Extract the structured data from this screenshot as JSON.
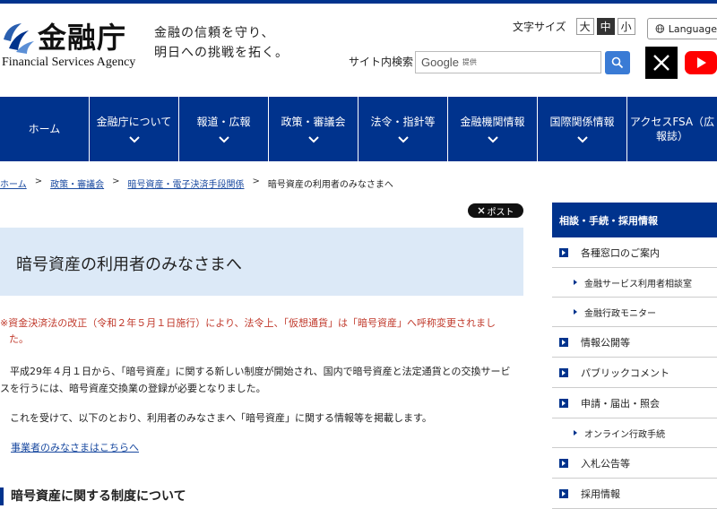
{
  "header": {
    "org_name": "金融庁",
    "org_name_en": "Financial Services Agency",
    "tagline_line1": "金融の信頼を守り、",
    "tagline_line2": "明日への挑戦を拓く。",
    "font_size_label": "文字サイズ",
    "font_sizes": [
      "大",
      "中",
      "小"
    ],
    "font_size_selected": "中",
    "language_label": "Language",
    "search_label": "サイト内検索",
    "search_placeholder_brand": "Google",
    "search_placeholder_sub": "提供",
    "icons": {
      "search": "search-icon",
      "globe": "globe-icon",
      "x": "x-logo-icon",
      "youtube": "youtube-icon"
    }
  },
  "nav": {
    "items": [
      {
        "label": "ホーム",
        "has_chevron": false
      },
      {
        "label": "金融庁について",
        "has_chevron": true
      },
      {
        "label": "報道・広報",
        "has_chevron": true
      },
      {
        "label": "政策・審議会",
        "has_chevron": true
      },
      {
        "label": "法令・指針等",
        "has_chevron": true
      },
      {
        "label": "金融機関情報",
        "has_chevron": true
      },
      {
        "label": "国際関係情報",
        "has_chevron": true
      },
      {
        "label": "アクセスFSA（広報誌）",
        "has_chevron": false
      }
    ]
  },
  "breadcrumb": {
    "items": [
      "ホーム",
      "政策・審議会",
      "暗号資産・電子決済手段関係",
      "暗号資産の利用者のみなさまへ"
    ]
  },
  "share": {
    "post_label": "ポスト"
  },
  "main": {
    "title": "暗号資産の利用者のみなさまへ",
    "note_line1": "※資金決済法の改正（令和２年５月１日施行）により、法令上、「仮想通貨」は「暗号資産」へ呼称変更されまし",
    "note_line2": "た。",
    "para1_line1": "　平成29年４月１日から、「暗号資産」に関する新しい制度が開始され、国内で暗号資産と法定通貨との交換サービ",
    "para1_line2": "スを行うには、暗号資産交換業の登録が必要となりました。",
    "para2": "　これを受けて、以下のとおり、利用者のみなさまへ「暗号資産」に関する情報等を掲載します。",
    "link": "事業者のみなさまはこちらへ",
    "section_heading": "暗号資産に関する制度について"
  },
  "sidebar": {
    "heading": "相談・手続・採用情報",
    "items": [
      {
        "label": "各種窓口のご案内",
        "level": "main"
      },
      {
        "label": "金融サービス利用者相談室",
        "level": "sub"
      },
      {
        "label": "金融行政モニター",
        "level": "sub"
      },
      {
        "label": "情報公開等",
        "level": "main"
      },
      {
        "label": "パブリックコメント",
        "level": "main"
      },
      {
        "label": "申請・届出・照会",
        "level": "main"
      },
      {
        "label": "オンライン行政手続",
        "level": "sub"
      },
      {
        "label": "入札公告等",
        "level": "main"
      },
      {
        "label": "採用情報",
        "level": "main"
      }
    ]
  },
  "colors": {
    "brand": "#00338d",
    "title_bg": "#dce9f7",
    "note_text": "#c0392b",
    "link": "#1a4aa0"
  }
}
